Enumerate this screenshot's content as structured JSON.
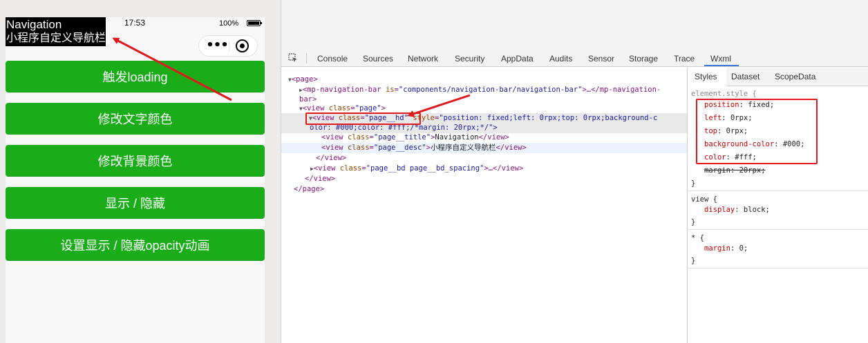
{
  "simulator": {
    "status": {
      "time": "17:53",
      "battery": "100%"
    },
    "nav": {
      "title": "Navigation",
      "desc": "小程序自定义导航栏"
    },
    "capsule": {
      "menu_icon": "more-dots-icon",
      "close_icon": "target-circle-icon"
    },
    "buttons": [
      "触发loading",
      "修改文字颜色",
      "修改背景颜色",
      "显示 / 隐藏",
      "设置显示 / 隐藏opacity动画"
    ],
    "button_color": "#1aad19"
  },
  "devtools": {
    "tabs": [
      "Console",
      "Sources",
      "Network",
      "Security",
      "AppData",
      "Audits",
      "Sensor",
      "Storage",
      "Trace",
      "Wxml"
    ],
    "active_tab": "Wxml",
    "tree": {
      "l1_tag": "<page>",
      "l2_open": "<mp-navigation-bar ",
      "l2_attr": "is",
      "l2_val": "\"components/navigation-bar/navigation-bar\"",
      "l2_close": ">…</mp-navigation-",
      "l2_wrap": "bar>",
      "l3_open": "<view ",
      "l3_attr": "class",
      "l3_val": "\"page\"",
      "l3_close": ">",
      "l4_open": "<view ",
      "l4_attr": "class",
      "l4_val": "\"page__hd\"",
      "l4_style_attr": "style",
      "l4_style_val": "\"position: fixed;left: 0rpx;top: 0rpx;background-c",
      "l4_wrap": "olor: #000;color: #fff;/*margin: 20rpx;*/\">",
      "l5_open": "<view ",
      "l5_attr": "class",
      "l5_val": "\"page__title\"",
      "l5_text": "Navigation",
      "l5_close": "</view>",
      "l6_open": "<view ",
      "l6_attr": "class",
      "l6_val": "\"page__desc\"",
      "l6_text": "小程序自定义导航栏",
      "l6_close": "</view>",
      "l7": "</view>",
      "l8_open": "<view ",
      "l8_attr": "class",
      "l8_val": "\"page__bd page__bd_spacing\"",
      "l8_close": ">…</view>",
      "l9": "</view>",
      "l10": "</page>"
    },
    "subtabs": [
      "Styles",
      "Dataset",
      "ScopeData"
    ],
    "styles": {
      "element_selector": "element.style {",
      "element_props": [
        {
          "name": "position",
          "value": "fixed;"
        },
        {
          "name": "left",
          "value": "0rpx;"
        },
        {
          "name": "top",
          "value": "0rpx;"
        },
        {
          "name": "background-color",
          "value": "#000;"
        },
        {
          "name": "color",
          "value": "#fff;"
        }
      ],
      "struck_prop": {
        "name": "margin",
        "value": "20rpx;"
      },
      "close": "}",
      "view_selector": "view {",
      "view_prop": {
        "name": "display",
        "value": "block;"
      },
      "star_selector": "* {",
      "star_prop": {
        "name": "margin",
        "value": "0;"
      }
    },
    "highlight_color": "#e0191e"
  }
}
